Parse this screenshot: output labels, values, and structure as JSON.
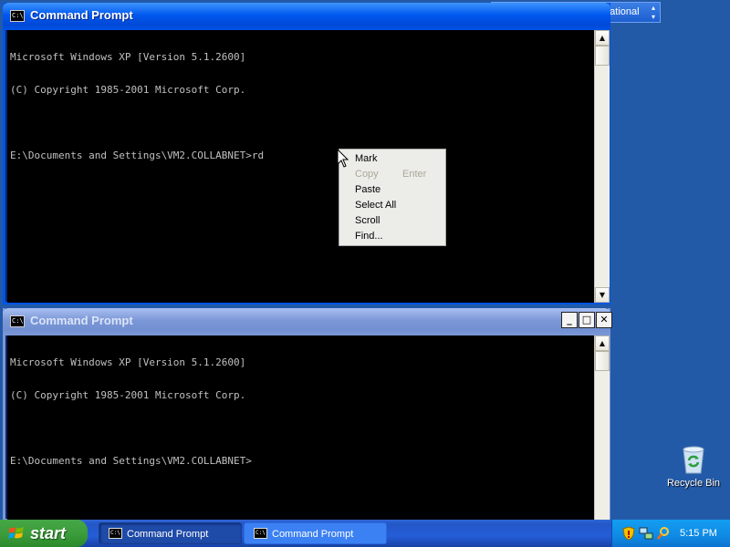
{
  "language_bar": {
    "text": "EN United States-International"
  },
  "windows": [
    {
      "title": "Command Prompt",
      "state": "active",
      "lines": [
        "Microsoft Windows XP [Version 5.1.2600]",
        "(C) Copyright 1985-2001 Microsoft Corp.",
        "",
        "E:\\Documents and Settings\\VM2.COLLABNET>rd"
      ]
    },
    {
      "title": "Command Prompt",
      "state": "inactive",
      "lines": [
        "Microsoft Windows XP [Version 5.1.2600]",
        "(C) Copyright 1985-2001 Microsoft Corp.",
        "",
        "E:\\Documents and Settings\\VM2.COLLABNET>"
      ]
    }
  ],
  "context_menu": {
    "items": [
      {
        "label": "Mark",
        "shortcut": "",
        "enabled": true
      },
      {
        "label": "Copy",
        "shortcut": "Enter",
        "enabled": false
      },
      {
        "label": "Paste",
        "shortcut": "",
        "enabled": true
      },
      {
        "label": "Select All",
        "shortcut": "",
        "enabled": true
      },
      {
        "label": "Scroll",
        "shortcut": "",
        "enabled": true
      },
      {
        "label": "Find...",
        "shortcut": "",
        "enabled": true
      }
    ]
  },
  "desktop_icons": [
    {
      "label": "Recycle Bin",
      "icon": "recycle-bin-icon"
    }
  ],
  "taskbar": {
    "start_label": "start",
    "buttons": [
      {
        "label": "Command Prompt",
        "pressed": true
      },
      {
        "label": "Command Prompt",
        "pressed": false
      }
    ],
    "tray_icons": [
      "security-shield-icon",
      "network-icon",
      "search-icon"
    ],
    "clock": "5:15 PM"
  },
  "icon_text": {
    "cmd": "C:\\"
  },
  "colors": {
    "console_bg": "#000000",
    "console_text": "#c0c0c0",
    "active_title": "#0058ee",
    "inactive_title": "#7b97d6",
    "desktop": "#235aa8"
  }
}
